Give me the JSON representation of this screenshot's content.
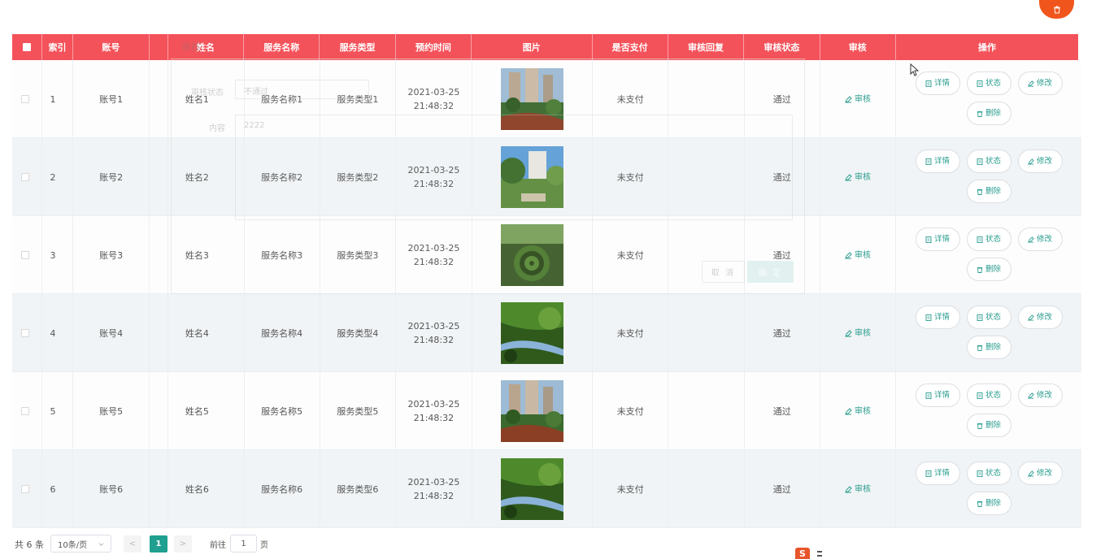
{
  "toolbar": {
    "delete_icon": "trash-icon",
    "accent_color": "#f0561c"
  },
  "table": {
    "header_color": "#f4525a",
    "columns": [
      {
        "key": "check",
        "label": ""
      },
      {
        "key": "index",
        "label": "索引"
      },
      {
        "key": "account",
        "label": "账号"
      },
      {
        "key": "blank",
        "label": ""
      },
      {
        "key": "name",
        "label": "姓名"
      },
      {
        "key": "service_name",
        "label": "服务名称"
      },
      {
        "key": "service_type",
        "label": "服务类型"
      },
      {
        "key": "time",
        "label": "预约时间"
      },
      {
        "key": "image",
        "label": "图片"
      },
      {
        "key": "paid",
        "label": "是否支付"
      },
      {
        "key": "reply",
        "label": "审核回复"
      },
      {
        "key": "status",
        "label": "审核状态"
      },
      {
        "key": "audit",
        "label": "审核"
      },
      {
        "key": "ops",
        "label": "操作"
      }
    ],
    "rows": [
      {
        "index": "1",
        "account": "账号1",
        "name": "姓名1",
        "service_name": "服务名称1",
        "service_type": "服务类型1",
        "time": "2021-03-25 21:48:32",
        "image": "residential-garden-photo",
        "paid": "未支付",
        "reply": "",
        "status": "通过",
        "audit": "审核"
      },
      {
        "index": "2",
        "account": "账号2",
        "name": "姓名2",
        "service_name": "服务名称2",
        "service_type": "服务类型2",
        "time": "2021-03-25 21:48:32",
        "image": "apartment-garden-photo",
        "paid": "未支付",
        "reply": "",
        "status": "通过",
        "audit": "审核"
      },
      {
        "index": "3",
        "account": "账号3",
        "name": "姓名3",
        "service_name": "服务名称3",
        "service_type": "服务类型3",
        "time": "2021-03-25 21:48:32",
        "image": "hedge-maze-photo",
        "paid": "未支付",
        "reply": "",
        "status": "通过",
        "audit": "审核"
      },
      {
        "index": "4",
        "account": "账号4",
        "name": "姓名4",
        "service_name": "服务名称4",
        "service_type": "服务类型4",
        "time": "2021-03-25 21:48:32",
        "image": "willow-stream-photo",
        "paid": "未支付",
        "reply": "",
        "status": "通过",
        "audit": "审核"
      },
      {
        "index": "5",
        "account": "账号5",
        "name": "姓名5",
        "service_name": "服务名称5",
        "service_type": "服务类型5",
        "time": "2021-03-25 21:48:32",
        "image": "residential-garden-photo",
        "paid": "未支付",
        "reply": "",
        "status": "通过",
        "audit": "审核"
      },
      {
        "index": "6",
        "account": "账号6",
        "name": "姓名6",
        "service_name": "服务名称6",
        "service_type": "服务类型6",
        "time": "2021-03-25 21:48:32",
        "image": "willow-stream-photo",
        "paid": "未支付",
        "reply": "",
        "status": "通过",
        "audit": "审核"
      }
    ],
    "actions": {
      "detail": "详情",
      "state": "状态",
      "edit": "修改",
      "delete": "删除"
    },
    "action_color": "#2a9d8f"
  },
  "dialog": {
    "title": "审核",
    "status_label": "审核状态",
    "status_value": "不通过",
    "content_label": "内容",
    "content_value": "2222",
    "cancel_label": "取 消",
    "confirm_label": "确 定"
  },
  "pagination": {
    "total_text": "共 6 条",
    "page_size": "10条/页",
    "prev": "<",
    "current_page": "1",
    "next": ">",
    "goto_label": "前往",
    "goto_value": "1",
    "page_unit": "页",
    "active_color": "#1f9f8f"
  },
  "corner_logo": {
    "letter": "S"
  }
}
